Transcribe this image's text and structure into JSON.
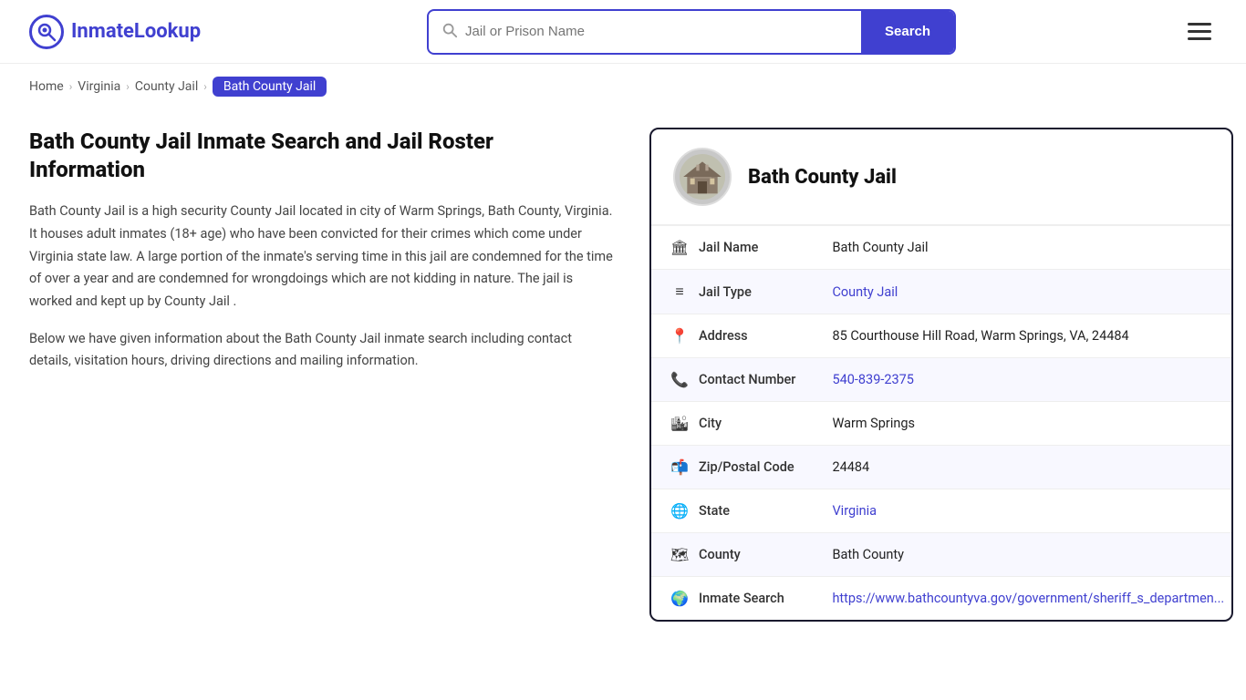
{
  "header": {
    "logo_icon": "Q",
    "logo_brand": "InmateLookup",
    "logo_brand_prefix": "Inmate",
    "logo_brand_suffix": "Lookup",
    "search_placeholder": "Jail or Prison Name",
    "search_button_label": "Search"
  },
  "breadcrumb": {
    "home": "Home",
    "virginia": "Virginia",
    "county_jail": "County Jail",
    "current": "Bath County Jail"
  },
  "main": {
    "page_title": "Bath County Jail Inmate Search and Jail Roster Information",
    "description1": "Bath County Jail is a high security County Jail located in city of Warm Springs, Bath County, Virginia. It houses adult inmates (18+ age) who have been convicted for their crimes which come under Virginia state law. A large portion of the inmate's serving time in this jail are condemned for the time of over a year and are condemned for wrongdoings which are not kidding in nature. The jail is worked and kept up by County Jail .",
    "description2": "Below we have given information about the Bath County Jail inmate search including contact details, visitation hours, driving directions and mailing information."
  },
  "card": {
    "title": "Bath County Jail",
    "rows": [
      {
        "icon": "🏛",
        "label": "Jail Name",
        "value": "Bath County Jail",
        "type": "text"
      },
      {
        "icon": "≡",
        "label": "Jail Type",
        "value": "County Jail",
        "type": "link",
        "href": "#"
      },
      {
        "icon": "📍",
        "label": "Address",
        "value": "85 Courthouse Hill Road, Warm Springs, VA, 24484",
        "type": "text"
      },
      {
        "icon": "📞",
        "label": "Contact Number",
        "value": "540-839-2375",
        "type": "link",
        "href": "tel:540-839-2375"
      },
      {
        "icon": "🏙",
        "label": "City",
        "value": "Warm Springs",
        "type": "text"
      },
      {
        "icon": "📬",
        "label": "Zip/Postal Code",
        "value": "24484",
        "type": "text"
      },
      {
        "icon": "🌐",
        "label": "State",
        "value": "Virginia",
        "type": "link",
        "href": "#"
      },
      {
        "icon": "🗺",
        "label": "County",
        "value": "Bath County",
        "type": "text"
      },
      {
        "icon": "🌍",
        "label": "Inmate Search",
        "value": "https://www.bathcountyva.gov/government/sheriff_s_departmen...",
        "type": "link",
        "href": "https://www.bathcountyva.gov/government/sheriff_s_department"
      }
    ]
  }
}
